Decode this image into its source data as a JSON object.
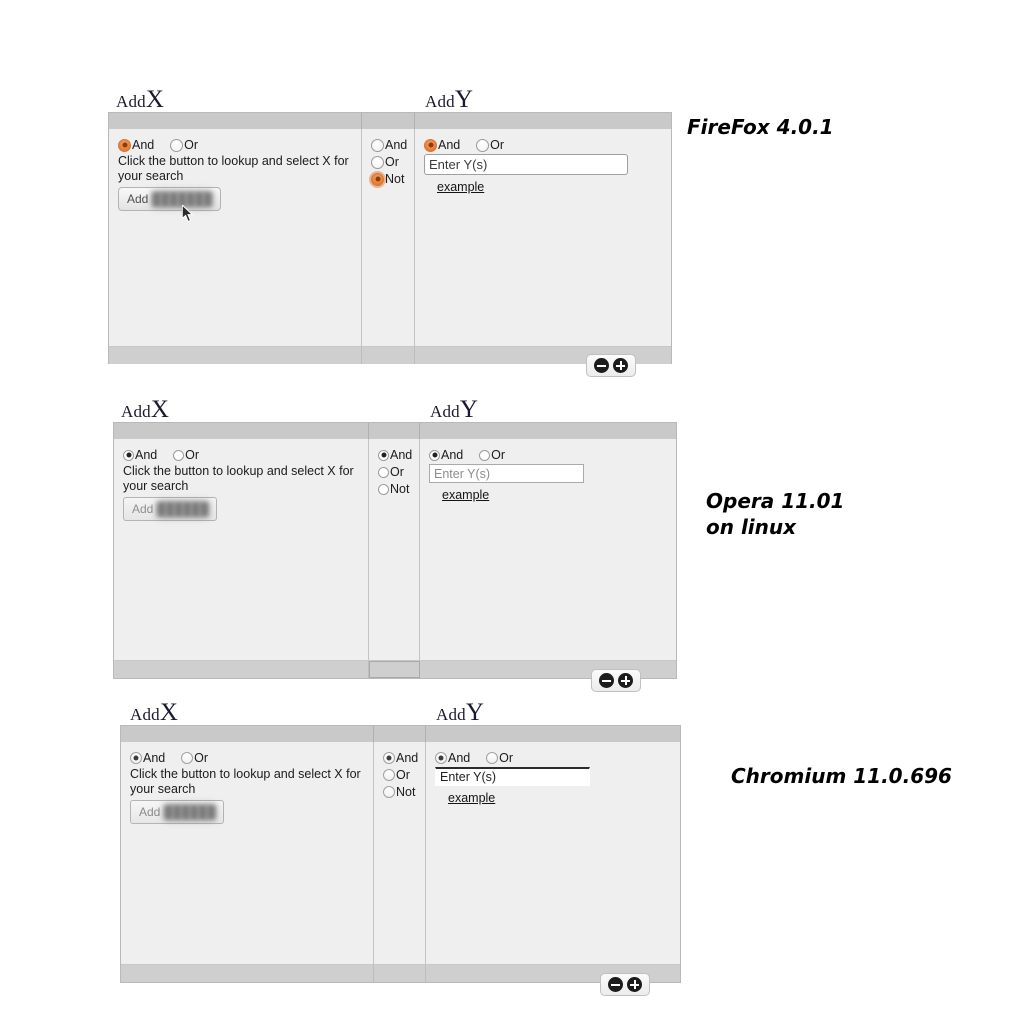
{
  "page": {
    "background": "#ffffff",
    "accent_orange": "#e06c1f"
  },
  "samples": [
    {
      "id": "firefox",
      "caption": "FireFox 4.0.1",
      "titles": {
        "x": {
          "prefix": "Add",
          "letter": "X"
        },
        "y": {
          "prefix": "Add",
          "letter": "Y"
        }
      },
      "left_column": {
        "radios": [
          {
            "label": "And",
            "selected": true,
            "focused": false
          },
          {
            "label": "Or",
            "selected": false,
            "focused": false
          }
        ],
        "help_text": "Click the button to lookup and select X for your search",
        "button": {
          "label": "Add",
          "redacted_suffix": "███████"
        }
      },
      "middle_column": {
        "radios": [
          {
            "label": "And",
            "selected": false,
            "focused": false
          },
          {
            "label": "Or",
            "selected": false,
            "focused": false
          },
          {
            "label": "Not",
            "selected": true,
            "focused": true
          }
        ]
      },
      "right_column": {
        "radios": [
          {
            "label": "And",
            "selected": true,
            "focused": false
          },
          {
            "label": "Or",
            "selected": false,
            "focused": false
          }
        ],
        "input": {
          "value": "Enter Y(s)",
          "placeholder": "Enter Y(s)"
        },
        "example_link": "example"
      },
      "footer": {
        "minus_label": "remove-row",
        "plus_label": "add-row"
      },
      "cursor_visible": true
    },
    {
      "id": "opera",
      "caption": "Opera 11.01\non linux",
      "titles": {
        "x": {
          "prefix": "Add",
          "letter": "X"
        },
        "y": {
          "prefix": "Add",
          "letter": "Y"
        }
      },
      "left_column": {
        "radios": [
          {
            "label": "And",
            "selected": true,
            "focused": false
          },
          {
            "label": "Or",
            "selected": false,
            "focused": false
          }
        ],
        "help_text": "Click the button to lookup and select X for your search",
        "button": {
          "label": "Add",
          "redacted_suffix": "██████"
        }
      },
      "middle_column": {
        "radios": [
          {
            "label": "And",
            "selected": true,
            "focused": false
          },
          {
            "label": "Or",
            "selected": false,
            "focused": false
          },
          {
            "label": "Not",
            "selected": false,
            "focused": false
          }
        ]
      },
      "right_column": {
        "radios": [
          {
            "label": "And",
            "selected": true,
            "focused": false
          },
          {
            "label": "Or",
            "selected": false,
            "focused": false
          }
        ],
        "input": {
          "value": "Enter Y(s)",
          "placeholder": "Enter Y(s)"
        },
        "example_link": "example"
      },
      "footer": {
        "minus_label": "remove-row",
        "plus_label": "add-row"
      },
      "cursor_visible": false
    },
    {
      "id": "chromium",
      "caption": "Chromium 11.0.696",
      "titles": {
        "x": {
          "prefix": "Add",
          "letter": "X"
        },
        "y": {
          "prefix": "Add",
          "letter": "Y"
        }
      },
      "left_column": {
        "radios": [
          {
            "label": "And",
            "selected": true,
            "focused": false
          },
          {
            "label": "Or",
            "selected": false,
            "focused": false
          }
        ],
        "help_text": "Click the button to lookup and select X for your search",
        "button": {
          "label": "Add",
          "redacted_suffix": "██████"
        }
      },
      "middle_column": {
        "radios": [
          {
            "label": "And",
            "selected": true,
            "focused": false
          },
          {
            "label": "Or",
            "selected": false,
            "focused": false
          },
          {
            "label": "Not",
            "selected": false,
            "focused": false
          }
        ]
      },
      "right_column": {
        "radios": [
          {
            "label": "And",
            "selected": true,
            "focused": false
          },
          {
            "label": "Or",
            "selected": false,
            "focused": false
          }
        ],
        "input": {
          "value": "Enter Y(s)",
          "placeholder": "Enter Y(s)"
        },
        "example_link": "example"
      },
      "footer": {
        "minus_label": "remove-row",
        "plus_label": "add-row"
      },
      "cursor_visible": false
    }
  ]
}
